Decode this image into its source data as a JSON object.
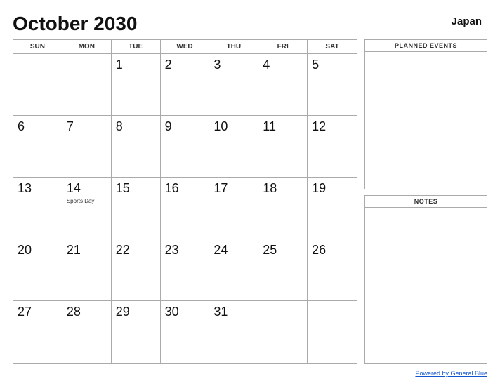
{
  "header": {
    "title": "October 2030",
    "country": "Japan"
  },
  "day_headers": [
    "SUN",
    "MON",
    "TUE",
    "WED",
    "THU",
    "FRI",
    "SAT"
  ],
  "weeks": [
    [
      {
        "num": "",
        "event": ""
      },
      {
        "num": "",
        "event": ""
      },
      {
        "num": "1",
        "event": ""
      },
      {
        "num": "2",
        "event": ""
      },
      {
        "num": "3",
        "event": ""
      },
      {
        "num": "4",
        "event": ""
      },
      {
        "num": "5",
        "event": ""
      }
    ],
    [
      {
        "num": "6",
        "event": ""
      },
      {
        "num": "7",
        "event": ""
      },
      {
        "num": "8",
        "event": ""
      },
      {
        "num": "9",
        "event": ""
      },
      {
        "num": "10",
        "event": ""
      },
      {
        "num": "11",
        "event": ""
      },
      {
        "num": "12",
        "event": ""
      }
    ],
    [
      {
        "num": "13",
        "event": ""
      },
      {
        "num": "14",
        "event": "Sports Day"
      },
      {
        "num": "15",
        "event": ""
      },
      {
        "num": "16",
        "event": ""
      },
      {
        "num": "17",
        "event": ""
      },
      {
        "num": "18",
        "event": ""
      },
      {
        "num": "19",
        "event": ""
      }
    ],
    [
      {
        "num": "20",
        "event": ""
      },
      {
        "num": "21",
        "event": ""
      },
      {
        "num": "22",
        "event": ""
      },
      {
        "num": "23",
        "event": ""
      },
      {
        "num": "24",
        "event": ""
      },
      {
        "num": "25",
        "event": ""
      },
      {
        "num": "26",
        "event": ""
      }
    ],
    [
      {
        "num": "27",
        "event": ""
      },
      {
        "num": "28",
        "event": ""
      },
      {
        "num": "29",
        "event": ""
      },
      {
        "num": "30",
        "event": ""
      },
      {
        "num": "31",
        "event": ""
      },
      {
        "num": "",
        "event": ""
      },
      {
        "num": "",
        "event": ""
      }
    ]
  ],
  "panels": {
    "planned_events_label": "PLANNED EVENTS",
    "notes_label": "NOTES"
  },
  "footer": {
    "link_text": "Powered by General Blue",
    "link_url": "#"
  }
}
